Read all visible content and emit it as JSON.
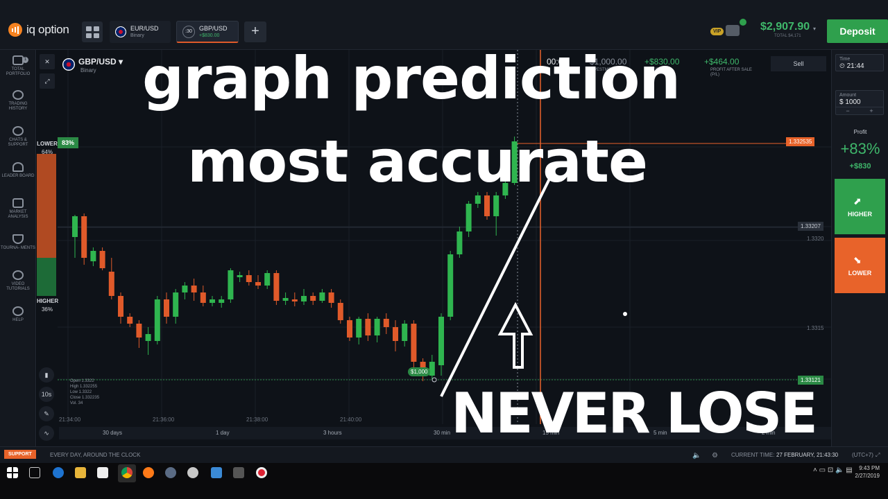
{
  "topbar": {
    "logo_text": "iq option",
    "tabs": [
      {
        "name": "EUR/USD",
        "sub": "Binary"
      },
      {
        "name": "GBP/USD",
        "sub": "+$830.00",
        "timer": ":30"
      }
    ],
    "vip": "VIP",
    "balance": "$2,907.90",
    "balance_sub": "TOTAL $4,171",
    "deposit_label": "Deposit"
  },
  "sidebar": {
    "items": [
      {
        "label": "TOTAL PORTFOLIO",
        "badge": "1"
      },
      {
        "label": "TRADING HISTORY"
      },
      {
        "label": "CHATS & SUPPORT"
      },
      {
        "label": "LEADER BOARD"
      },
      {
        "label": "MARKET ANALYSIS"
      },
      {
        "label": "TOURNA- MENTS"
      },
      {
        "label": "VIDEO TUTORIALS"
      },
      {
        "label": "HELP"
      }
    ]
  },
  "chart": {
    "pair": "GBP/USD",
    "pair_type": "Binary",
    "lower_label": "LOWER",
    "lower_pct": "64%",
    "higher_label": "HIGHER",
    "higher_pct": "36%",
    "payout_tag": "83%",
    "info": {
      "timer": "00:00",
      "investment": "$1,000.00",
      "investment_label": "INVESTMENT",
      "expected": "+$830.00",
      "expected_label": "EXPECTED",
      "profit_after_sale": "+$464.00",
      "profit_after_sale_label": "PROFIT AFTER SALE (P/L)",
      "sell_label": "Sell"
    },
    "price_tags": {
      "current": "1.332535",
      "level_1": "1.33207",
      "level_2": "1.3320",
      "level_3": "1.3315",
      "entry": "1.33121"
    },
    "bet_tag": "$1,000",
    "ohlc": {
      "open": "Open  1.3322",
      "high": "High  1.332255",
      "low": "Low  1.3322",
      "close": "Close 1.332235",
      "vol": "Vol.  34"
    },
    "time_labels": [
      "21:34:00",
      "21:36:00",
      "21:38:00",
      "21:40:00"
    ],
    "periods": [
      "30 days",
      "1 day",
      "3 hours",
      "30 min",
      "15 min",
      "5 min",
      "2 min"
    ],
    "interval": "10s"
  },
  "right_panel": {
    "time_label": "Time",
    "time_value": "21:44",
    "amount_label": "Amount",
    "amount_value": "$ 1000",
    "profit_label": "Profit",
    "profit_pct": "+83%",
    "profit_amount": "+$830",
    "higher_label": "HIGHER",
    "lower_label": "LOWER"
  },
  "overlay": {
    "line1": "graph prediction",
    "line2": "most accurate",
    "line3": "NEVER LOSE"
  },
  "statusbar": {
    "support": "SUPPORT",
    "slogan": "EVERY DAY, AROUND THE CLOCK",
    "current_time_label": "CURRENT TIME:",
    "current_time": "27 FEBRUARY, 21:43:30",
    "tz": "(UTC+7)"
  },
  "taskbar": {
    "time": "9:43 PM",
    "date": "2/27/2019"
  },
  "colors": {
    "green": "#2fa04d",
    "orange": "#e8632a",
    "red_candle": "#e05a2a",
    "green_candle": "#2fb54f"
  }
}
